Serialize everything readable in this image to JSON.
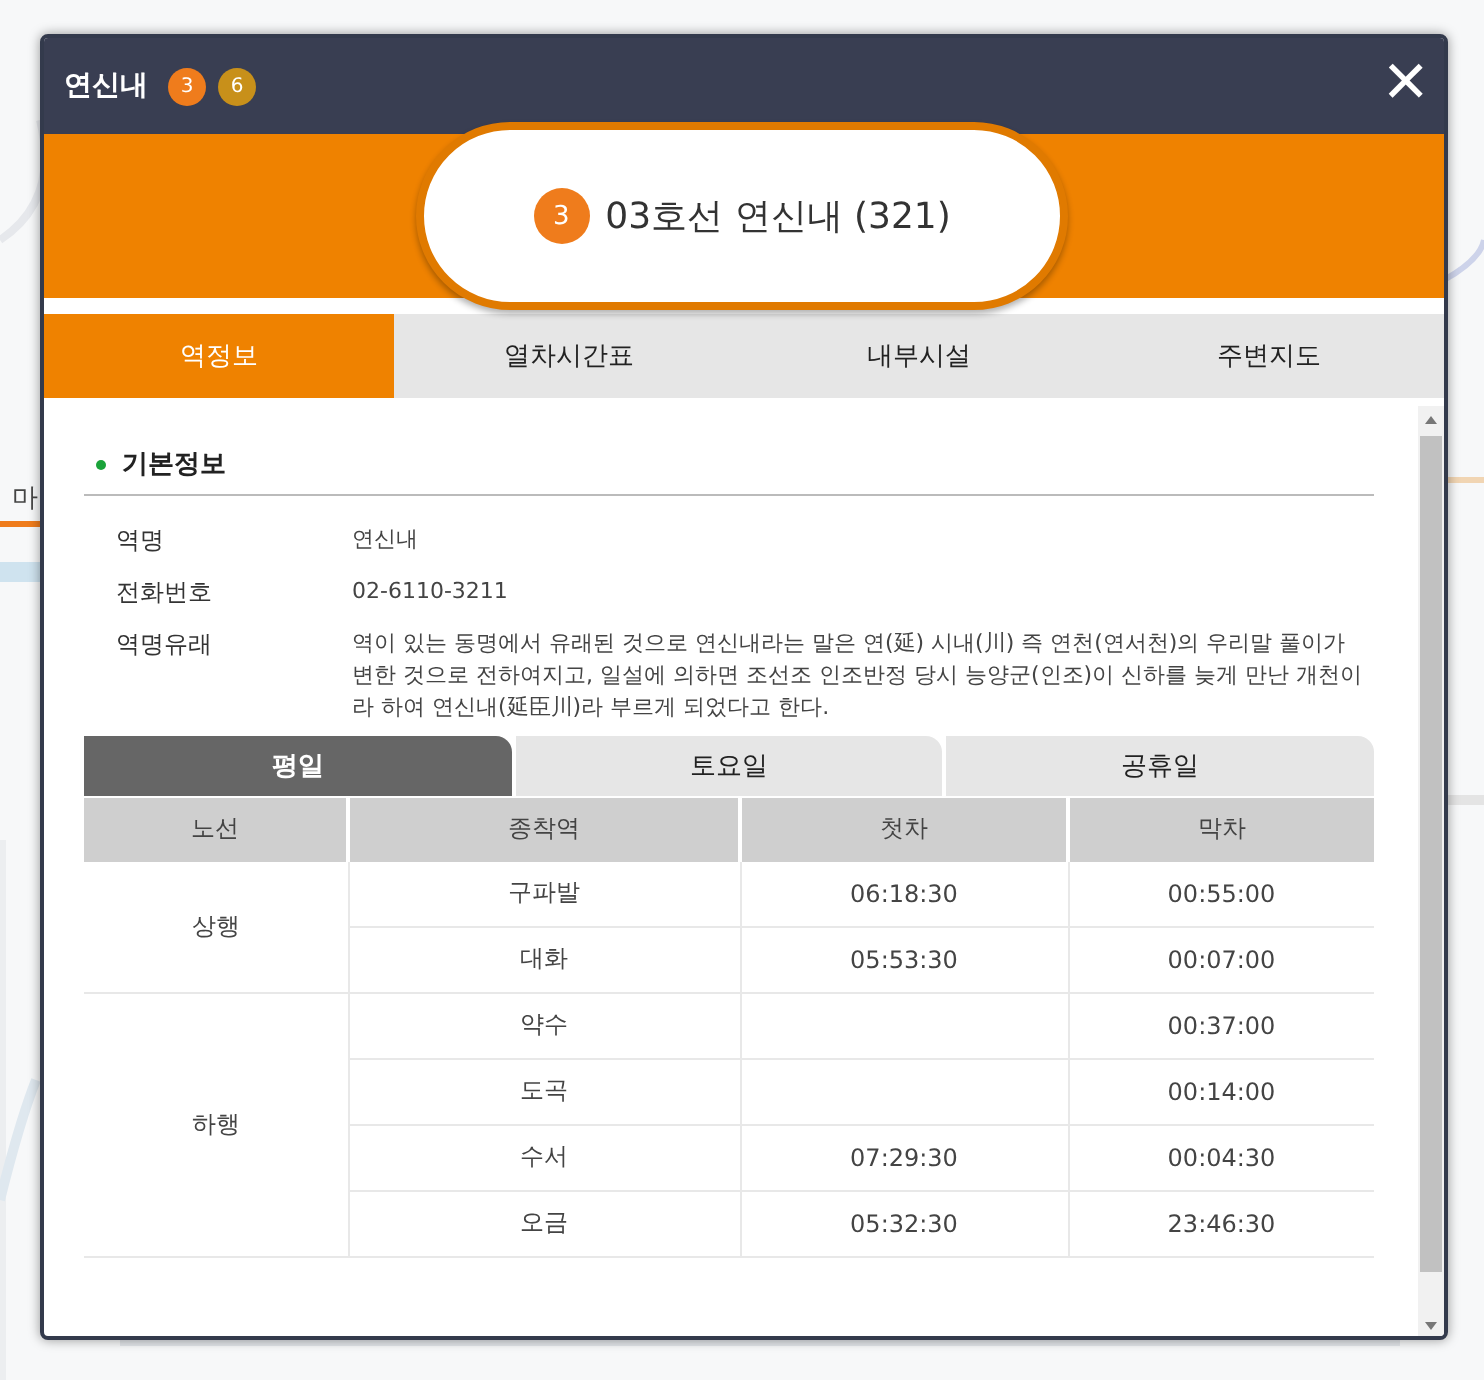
{
  "background": {
    "label": "마"
  },
  "window": {
    "title": "연신내",
    "lines": [
      {
        "label": "3",
        "color": "#ef7c1c"
      },
      {
        "label": "6",
        "color": "#c8901a"
      }
    ],
    "close": "×"
  },
  "station": {
    "line_badge": {
      "label": "3",
      "color": "#ef7c1c"
    },
    "name": "03호선 연신내 (321)"
  },
  "tabs": [
    {
      "label": "역정보",
      "selected": true
    },
    {
      "label": "열차시간표",
      "selected": false
    },
    {
      "label": "내부시설",
      "selected": false
    },
    {
      "label": "주변지도",
      "selected": false
    }
  ],
  "section": {
    "title": "기본정보"
  },
  "info": [
    {
      "label": "역명",
      "value": "연신내"
    },
    {
      "label": "전화번호",
      "value": "02-6110-3211"
    },
    {
      "label": "역명유래",
      "value": "역이 있는 동명에서 유래된 것으로 연신내라는 말은 연(延) 시내(川) 즉 연천(연서천)의 우리말 풀이가 변한 것으로 전하여지고, 일설에 의하면 조선조 인조반정 당시 능양군(인조)이 신하를 늦게 만난 개천이라 하여 연신내(延臣川)라 부르게 되었다고 한다."
    }
  ],
  "day_tabs": [
    {
      "label": "평일",
      "selected": true
    },
    {
      "label": "토요일",
      "selected": false
    },
    {
      "label": "공휴일",
      "selected": false
    }
  ],
  "table": {
    "columns": [
      "노선",
      "종착역",
      "첫차",
      "막차"
    ],
    "groups": [
      {
        "direction": "상행",
        "rows": [
          {
            "terminal": "구파발",
            "first": "06:18:30",
            "last": "00:55:00"
          },
          {
            "terminal": "대화",
            "first": "05:53:30",
            "last": "00:07:00"
          }
        ]
      },
      {
        "direction": "하행",
        "rows": [
          {
            "terminal": "약수",
            "last": "00:37:00"
          },
          {
            "terminal": "도곡",
            "last": "00:14:00"
          },
          {
            "terminal": "수서",
            "first": "07:29:30",
            "last": "00:04:30"
          },
          {
            "terminal": "오금",
            "first": "05:32:30",
            "last": "23:46:30"
          }
        ]
      }
    ]
  }
}
